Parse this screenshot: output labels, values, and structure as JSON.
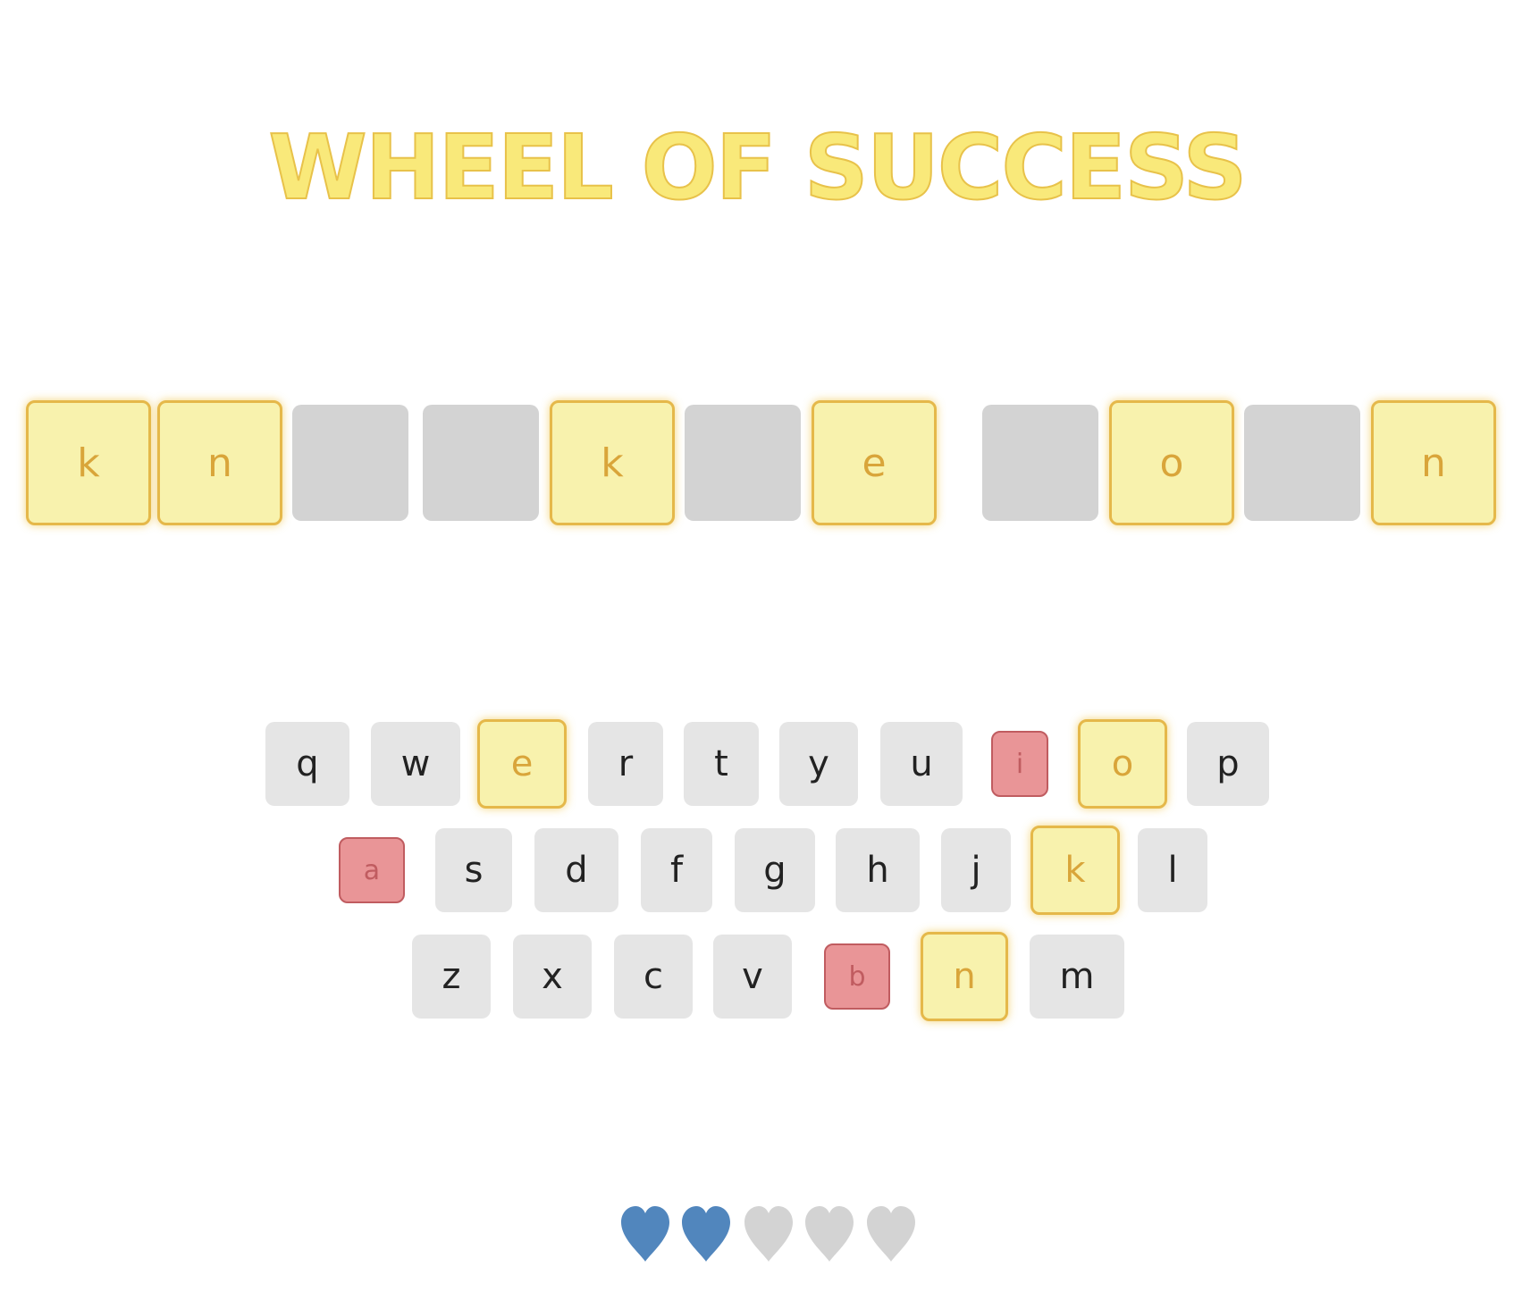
{
  "title": "WHEEL OF SUCCESS",
  "colors": {
    "revealed_fill": "#f8f2ad",
    "revealed_border": "#e5b84a",
    "revealed_text": "#d9a53a",
    "hidden_fill": "#d3d3d3",
    "key_fill": "#e5e5e5",
    "wrong_fill": "#e99597",
    "wrong_border": "#c05c60",
    "life_full": "#5186bd",
    "life_empty": "#d3d3d3"
  },
  "puzzle": [
    {
      "letter": "k",
      "state": "revealed"
    },
    {
      "letter": "n",
      "state": "revealed"
    },
    {
      "letter": "",
      "state": "hidden"
    },
    {
      "letter": "",
      "state": "hidden"
    },
    {
      "letter": "k",
      "state": "revealed"
    },
    {
      "letter": "",
      "state": "hidden"
    },
    {
      "letter": "e",
      "state": "revealed"
    },
    {
      "letter": "",
      "state": "hidden"
    },
    {
      "letter": "o",
      "state": "revealed"
    },
    {
      "letter": "",
      "state": "hidden"
    },
    {
      "letter": "n",
      "state": "revealed"
    }
  ],
  "keyboard": {
    "rows": [
      [
        {
          "label": "q",
          "state": "unused"
        },
        {
          "label": "w",
          "state": "unused"
        },
        {
          "label": "e",
          "state": "correct"
        },
        {
          "label": "r",
          "state": "unused"
        },
        {
          "label": "t",
          "state": "unused"
        },
        {
          "label": "y",
          "state": "unused"
        },
        {
          "label": "u",
          "state": "unused"
        },
        {
          "label": "i",
          "state": "wrong"
        },
        {
          "label": "o",
          "state": "correct"
        },
        {
          "label": "p",
          "state": "unused"
        }
      ],
      [
        {
          "label": "a",
          "state": "wrong"
        },
        {
          "label": "s",
          "state": "unused"
        },
        {
          "label": "d",
          "state": "unused"
        },
        {
          "label": "f",
          "state": "unused"
        },
        {
          "label": "g",
          "state": "unused"
        },
        {
          "label": "h",
          "state": "unused"
        },
        {
          "label": "j",
          "state": "unused"
        },
        {
          "label": "k",
          "state": "correct"
        },
        {
          "label": "l",
          "state": "unused"
        }
      ],
      [
        {
          "label": "z",
          "state": "unused"
        },
        {
          "label": "x",
          "state": "unused"
        },
        {
          "label": "c",
          "state": "unused"
        },
        {
          "label": "v",
          "state": "unused"
        },
        {
          "label": "b",
          "state": "wrong"
        },
        {
          "label": "n",
          "state": "correct"
        },
        {
          "label": "m",
          "state": "unused"
        }
      ]
    ]
  },
  "lives": {
    "total": 5,
    "remaining": 2
  }
}
